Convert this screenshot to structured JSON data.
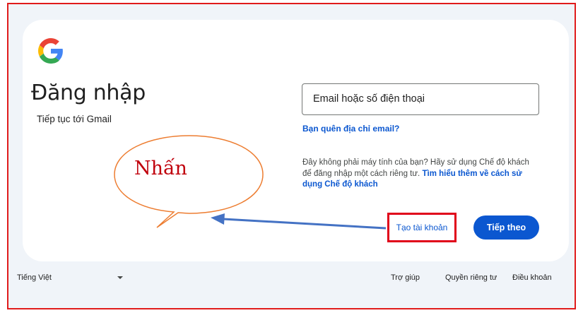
{
  "header": {
    "logo_icon": "google-g-icon",
    "title": "Đăng nhập",
    "subtitle": "Tiếp tục tới Gmail"
  },
  "form": {
    "email_placeholder": "Email hoặc số điện thoại",
    "email_value": "",
    "forgot_email": "Bạn quên địa chỉ email?",
    "guest_text": "Đây không phải máy tính của bạn? Hãy sử dụng Chế độ khách để đăng nhập một cách riêng tư.",
    "guest_link": "Tìm hiểu thêm về cách sử dụng Chế độ khách",
    "create_account": "Tạo tài khoản",
    "next": "Tiếp theo"
  },
  "footer": {
    "language": "Tiếng Việt",
    "help": "Trợ giúp",
    "privacy": "Quyền riêng tư",
    "terms": "Điều khoản"
  },
  "annotation": {
    "bubble_text": "Nhấn",
    "frame_color": "#e01b1b",
    "arrow_color": "#4472c4",
    "bubble_color": "#ed7d31"
  },
  "colors": {
    "accent": "#0b57d0",
    "page_bg": "#f0f4f9"
  }
}
